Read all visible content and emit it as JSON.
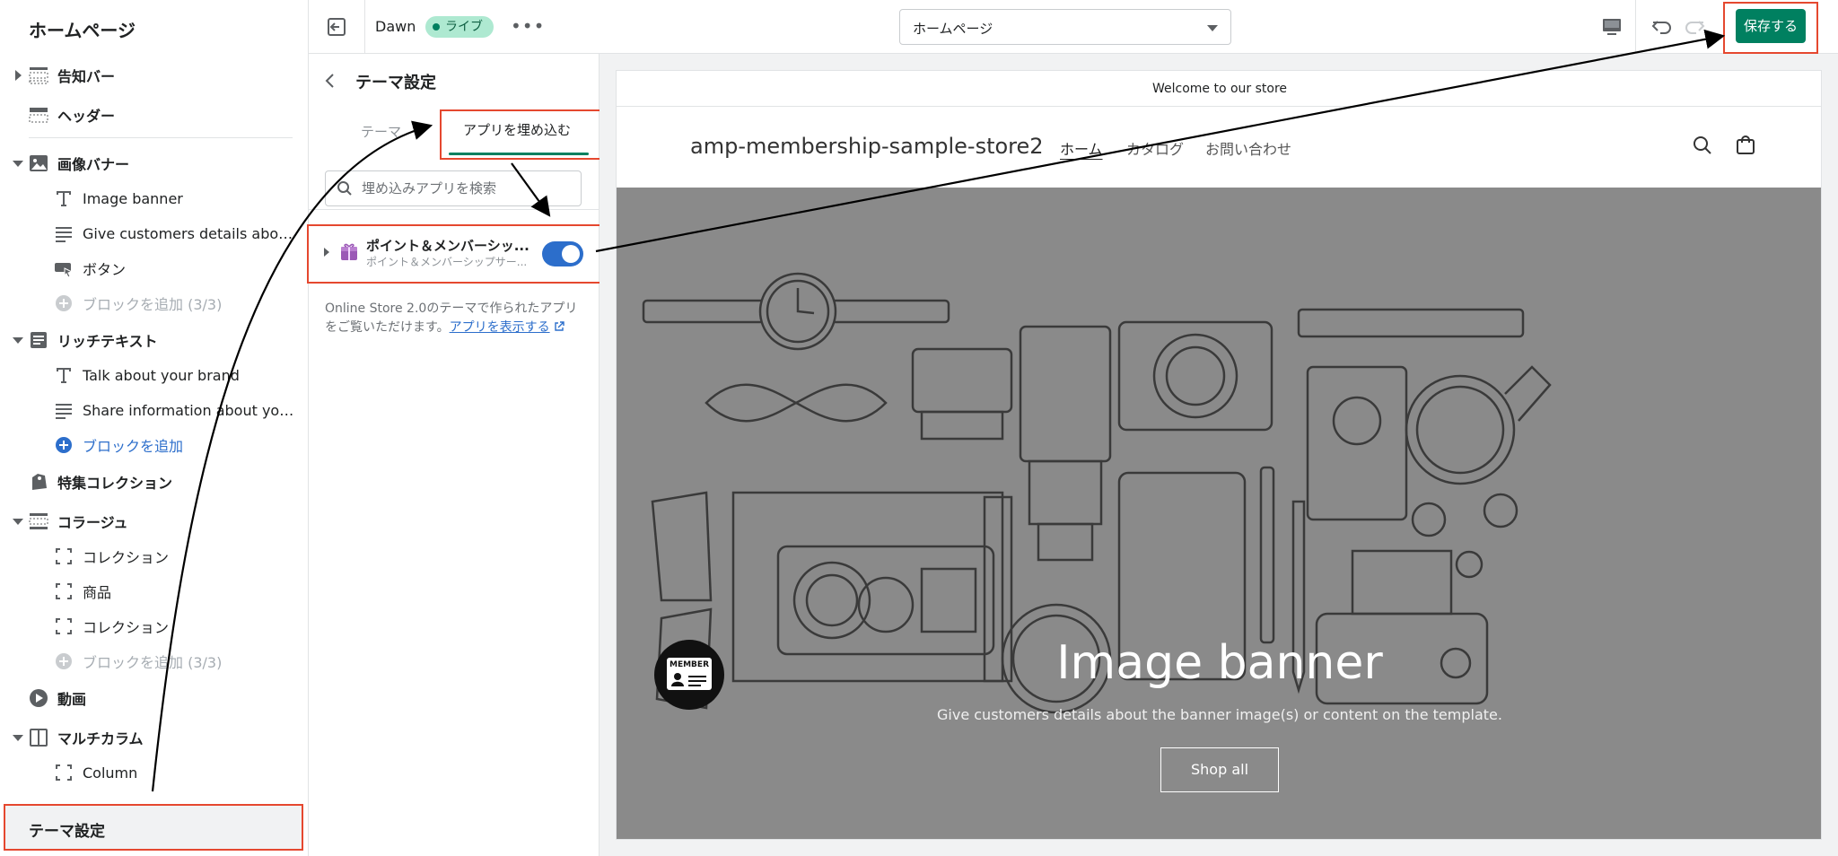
{
  "sidebar": {
    "title": "ホームページ",
    "sections": [
      {
        "id": "announce",
        "label": "告知バー",
        "icon": "announcement-bar-icon",
        "expanded": false
      },
      {
        "id": "header",
        "label": "ヘッダー",
        "icon": "header-icon"
      },
      {
        "id": "image-banner",
        "label": "画像バナー",
        "icon": "image-icon",
        "expanded": true,
        "blocks": [
          {
            "label": "Image banner",
            "icon": "text-icon"
          },
          {
            "label": "Give customers details about t...",
            "icon": "paragraph-icon"
          },
          {
            "label": "ボタン",
            "icon": "button-icon"
          },
          {
            "label": "ブロックを追加 (3/3)",
            "icon": "add-block-icon",
            "disabled": true
          }
        ]
      },
      {
        "id": "rich-text",
        "label": "リッチテキスト",
        "icon": "rich-text-icon",
        "expanded": true,
        "blocks": [
          {
            "label": "Talk about your brand",
            "icon": "text-icon"
          },
          {
            "label": "Share information about your b...",
            "icon": "paragraph-icon"
          },
          {
            "label": "ブロックを追加",
            "icon": "add-block-icon",
            "link": true
          }
        ]
      },
      {
        "id": "featured-collection",
        "label": "特集コレクション",
        "icon": "tag-icon"
      },
      {
        "id": "collage",
        "label": "コラージュ",
        "icon": "collage-icon",
        "expanded": true,
        "blocks": [
          {
            "label": "コレクション",
            "icon": "frame-icon"
          },
          {
            "label": "商品",
            "icon": "frame-icon"
          },
          {
            "label": "コレクション",
            "icon": "frame-icon"
          },
          {
            "label": "ブロックを追加 (3/3)",
            "icon": "add-block-icon",
            "disabled": true
          }
        ]
      },
      {
        "id": "video",
        "label": "動画",
        "icon": "play-icon"
      },
      {
        "id": "multicolumn",
        "label": "マルチカラム",
        "icon": "columns-icon",
        "expanded": true,
        "blocks": [
          {
            "label": "Column",
            "icon": "frame-icon"
          }
        ]
      }
    ],
    "theme_settings": "テーマ設定"
  },
  "topbar": {
    "theme_name": "Dawn",
    "live_badge": "ライブ",
    "more": "•••",
    "page_select": "ホームページ",
    "save": "保存する"
  },
  "panel": {
    "title": "テーマ設定",
    "tabs": [
      "テーマ",
      "アプリを埋め込む"
    ],
    "active_tab": 1,
    "search_placeholder": "埋め込みアプリを検索",
    "app": {
      "name": "ポイント＆メンバーシッ...",
      "subtitle": "ポイント＆メンバーシップサー...",
      "enabled": true
    },
    "note": "Online Store 2.0のテーマで作られたアプリをご覧いただけます。",
    "note_link": "アプリを表示する"
  },
  "preview": {
    "announcement": "Welcome to our store",
    "store_name": "amp-membership-sample-store2",
    "nav": [
      "ホーム",
      "カタログ",
      "お問い合わせ"
    ],
    "banner_title": "Image banner",
    "banner_subtitle": "Give customers details about the banner image(s) or content on the template.",
    "banner_button": "Shop all",
    "member_badge": "MEMBER"
  },
  "colors": {
    "accent_green": "#008060",
    "toggle_blue": "#2c6ecb",
    "highlight_red": "#e5482f",
    "banner_gray": "#8a8a8a"
  }
}
